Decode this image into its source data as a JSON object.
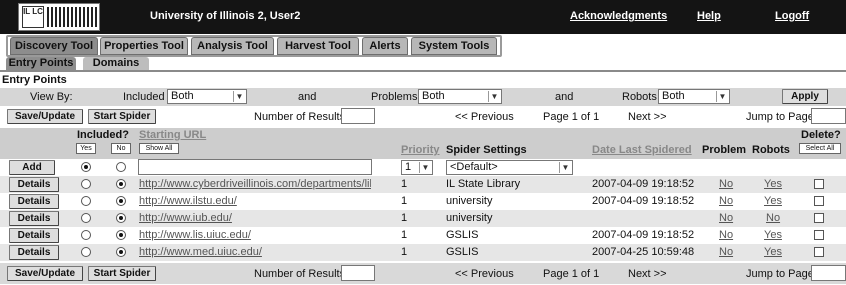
{
  "header": {
    "logo_text": "IL LC",
    "title": "University of Illinois 2, User2",
    "links": [
      "Acknowledgments",
      "Help",
      "Logoff"
    ]
  },
  "tabs": [
    "Discovery Tool",
    "Properties Tool",
    "Analysis Tool",
    "Harvest Tool",
    "Alerts",
    "System Tools"
  ],
  "subtabs": [
    "Entry Points",
    "Domains"
  ],
  "section_title": "Entry Points",
  "view_by": {
    "label": "View By:",
    "included_label": "Included",
    "included_value": "Both",
    "and1": "and",
    "problems_label": "Problems",
    "problems_value": "Both",
    "and2": "and",
    "robots_label": "Robots",
    "robots_value": "Both",
    "apply": "Apply"
  },
  "pager": {
    "save_update": "Save/Update",
    "start_spider": "Start Spider",
    "number_of_results": "Number of Results",
    "previous": "<< Previous",
    "page": "Page 1 of 1",
    "next": "Next >>",
    "jump_to_page": "Jump to Page"
  },
  "columns": {
    "included": "Included?",
    "yes": "Yes",
    "no": "No",
    "starting_url": "Starting URL",
    "show_all": "Show All",
    "priority": "Priority",
    "spider_settings": "Spider Settings",
    "date_last_spidered": "Date Last Spidered",
    "problem": "Problem",
    "robots": "Robots",
    "delete": "Delete?",
    "select_all": "Select All"
  },
  "add_row": {
    "add": "Add",
    "priority_value": "1",
    "settings_value": "<Default>"
  },
  "rows": [
    {
      "action": "Details",
      "url": "http://www.cyberdriveillinois.com/departments/library/",
      "priority": "1",
      "settings": "IL State Library",
      "date": "2007-04-09 19:18:52",
      "problem": "No",
      "robots": "Yes"
    },
    {
      "action": "Details",
      "url": "http://www.ilstu.edu/",
      "priority": "1",
      "settings": "university",
      "date": "2007-04-09 19:18:52",
      "problem": "No",
      "robots": "Yes"
    },
    {
      "action": "Details",
      "url": "http://www.iub.edu/",
      "priority": "1",
      "settings": "university",
      "date": "",
      "problem": "No",
      "robots": "No"
    },
    {
      "action": "Details",
      "url": "http://www.lis.uiuc.edu/",
      "priority": "1",
      "settings": "GSLIS",
      "date": "2007-04-09 19:18:52",
      "problem": "No",
      "robots": "Yes"
    },
    {
      "action": "Details",
      "url": "http://www.med.uiuc.edu/",
      "priority": "1",
      "settings": "GSLIS",
      "date": "2007-04-25 10:59:48",
      "problem": "No",
      "robots": "Yes"
    }
  ]
}
